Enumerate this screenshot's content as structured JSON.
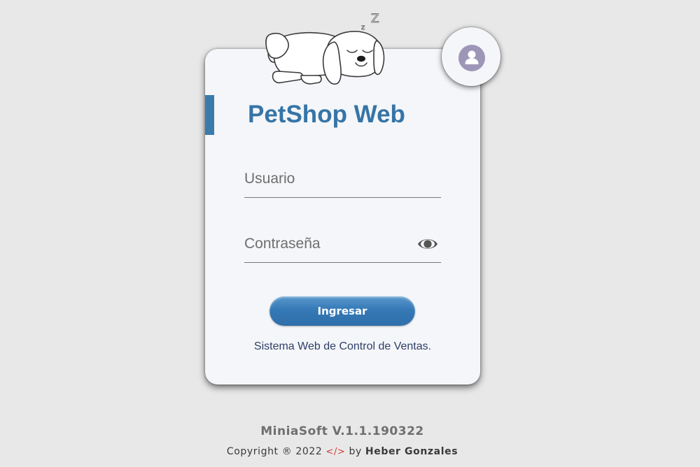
{
  "app": {
    "title": "PetShop Web",
    "subtitle": "Sistema Web de Control de Ventas."
  },
  "login": {
    "username_placeholder": "Usuario",
    "username_value": "",
    "password_placeholder": "Contraseña",
    "password_value": "",
    "submit_label": "Ingresar"
  },
  "decoration": {
    "sleep_glyph_big": "Z",
    "sleep_glyph_small": "z"
  },
  "footer": {
    "version": "MiniaSoft V.1.1.190322",
    "copyright_prefix": "Copyright ® 2022",
    "code_symbol": "</>",
    "by": "by",
    "author": "Heber Gonzales"
  },
  "icons": {
    "avatar": "user-icon",
    "password_toggle": "eye-icon",
    "mascot": "sleeping-dog-icon"
  },
  "colors": {
    "page_background": "#e8e8e8",
    "card_background": "#f4f6f9",
    "accent": "#3674a6",
    "button": "#3479b6",
    "avatar": "#9d96b8",
    "code_symbol": "#d23a3a"
  }
}
